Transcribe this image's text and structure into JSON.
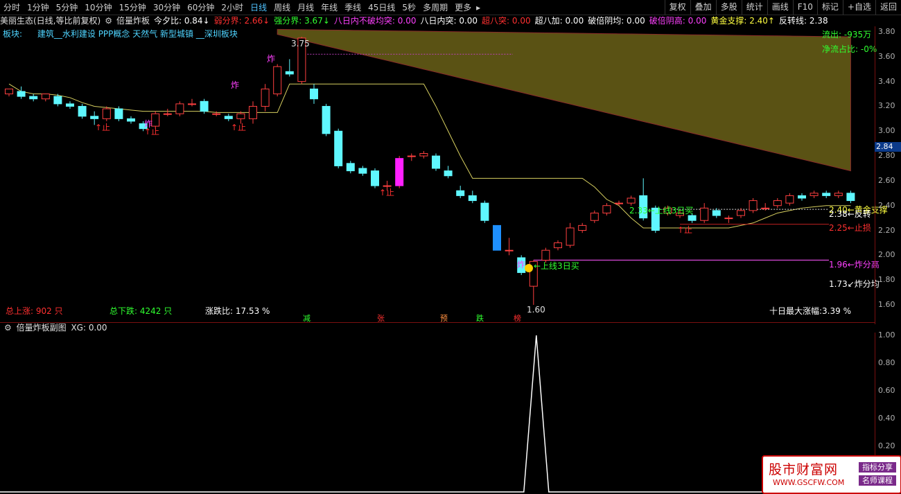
{
  "toolbar": {
    "periods": [
      "分时",
      "1分钟",
      "5分钟",
      "10分钟",
      "15分钟",
      "30分钟",
      "60分钟",
      "2小时",
      "日线",
      "周线",
      "月线",
      "年线",
      "季线",
      "45日线",
      "5秒",
      "多周期",
      "更多"
    ],
    "active_period": "日线",
    "more_arrow": "▸",
    "right_buttons": [
      "复权",
      "叠加",
      "多股",
      "统计",
      "画线",
      "F10",
      "标记",
      "+自选",
      "返回"
    ]
  },
  "info": {
    "stock": "美丽生态(日线,等比前复权)",
    "indicator": "倍量炸板",
    "items": [
      {
        "label": "今夕比: 0.84↓",
        "color": "#ffffff"
      },
      {
        "label": "弱分界: 2.66↓",
        "color": "#ff3030"
      },
      {
        "label": "强分界: 3.67↓",
        "color": "#30ff30"
      },
      {
        "label": "八日内不破均突: 0.00",
        "color": "#ff40ff"
      },
      {
        "label": "八日内突: 0.00",
        "color": "#ffffff"
      },
      {
        "label": "超八突: 0.00",
        "color": "#ff3030"
      },
      {
        "label": "超八加: 0.00",
        "color": "#ffffff"
      },
      {
        "label": "破倍阴均: 0.00",
        "color": "#ffffff"
      },
      {
        "label": "破倍阴高: 0.00",
        "color": "#ff40ff"
      },
      {
        "label": "黄金支撑: 2.40↑",
        "color": "#ffff40"
      },
      {
        "label": "反转线: 2.38",
        "color": "#ffffff"
      }
    ]
  },
  "block": {
    "label": "板块:",
    "value": "建筑__水利建设 PPP概念 天然气 新型城镇 __深圳板块"
  },
  "chart_texts": {
    "outflow": "流出: -935万",
    "net_ratio": "净流占比: -0%",
    "peak": "3.75",
    "zha1": "炸",
    "zha2": "炸",
    "zha3": "炸",
    "zhang1": "↑止",
    "zhang2": "↑止",
    "zhang3": "↑止",
    "zhang4": "↑止",
    "zhang5": "↑止",
    "low": "1.60",
    "upline1": "2.33←上线3日买",
    "upline2": "←上线3日买",
    "zha_low": "炸",
    "support": "2.40←黄金支撑",
    "reversal": "2.38←反转",
    "stoploss": "2.25←止损",
    "zha_avg1": "1.96←炸分高",
    "zha_avg2": "1.73↙炸分均",
    "total_up_label": "总上涨:",
    "total_up": "902 只",
    "total_down_label": "总下跌:",
    "total_down": "4242 只",
    "ratio_label": "涨跌比:",
    "ratio": "17.53 %",
    "tags": [
      "减",
      "张",
      "预",
      "跌",
      "榜"
    ],
    "ten_day": "十日最大涨幅:3.39 %"
  },
  "axis": {
    "labels": [
      "3.80",
      "3.60",
      "3.40",
      "3.20",
      "3.00",
      "2.80",
      "2.60",
      "2.40",
      "2.20",
      "2.00",
      "1.80",
      "1.60"
    ],
    "current": "2.84",
    "sub_labels": [
      "1.00",
      "0.80",
      "0.60",
      "0.40",
      "0.20",
      "0.00"
    ]
  },
  "sub": {
    "title": "倍量炸板副图",
    "value": "XG: 0.00"
  },
  "logo": {
    "title": "股市财富网",
    "url": "WWW.GSCFW.COM",
    "badge1": "指标分享",
    "badge2": "名师课程"
  },
  "chart_data": {
    "type": "candlestick",
    "price_range": [
      1.6,
      3.8
    ],
    "candles": [
      [
        3.3,
        3.34,
        3.28,
        3.32
      ],
      [
        3.32,
        3.28,
        3.36,
        3.26
      ],
      [
        3.28,
        3.26,
        3.3,
        3.24
      ],
      [
        3.26,
        3.3,
        3.24,
        3.28
      ],
      [
        3.28,
        3.22,
        3.3,
        3.2
      ],
      [
        3.22,
        3.2,
        3.24,
        3.18
      ],
      [
        3.2,
        3.12,
        3.22,
        3.1
      ],
      [
        3.12,
        3.1,
        3.16,
        3.05
      ],
      [
        3.1,
        3.18,
        3.08,
        3.2
      ],
      [
        3.18,
        3.1,
        3.2,
        3.08
      ],
      [
        3.1,
        3.08,
        3.12,
        3.06
      ],
      [
        3.06,
        3.02,
        3.08,
        3.0
      ],
      [
        3.04,
        3.14,
        3.02,
        3.16
      ],
      [
        3.14,
        3.14,
        3.18,
        3.12
      ],
      [
        3.14,
        3.22,
        3.12,
        3.24
      ],
      [
        3.22,
        3.22,
        3.26,
        3.2
      ],
      [
        3.24,
        3.16,
        3.26,
        3.14
      ],
      [
        3.14,
        3.14,
        3.16,
        3.12
      ],
      [
        3.12,
        3.1,
        3.14,
        3.08
      ],
      [
        3.1,
        3.14,
        3.06,
        3.16
      ],
      [
        3.1,
        3.2,
        3.06,
        3.24
      ],
      [
        3.2,
        3.34,
        3.16,
        3.38
      ],
      [
        3.3,
        3.52,
        3.28,
        3.54
      ],
      [
        3.48,
        3.46,
        3.58,
        3.44
      ],
      [
        3.4,
        3.75,
        3.38,
        3.76
      ],
      [
        3.34,
        3.26,
        3.38,
        3.22
      ],
      [
        3.2,
        2.98,
        3.22,
        2.96
      ],
      [
        3.0,
        2.72,
        3.02,
        2.7
      ],
      [
        2.74,
        2.68,
        2.76,
        2.66
      ],
      [
        2.7,
        2.66,
        2.72,
        2.64
      ],
      [
        2.68,
        2.56,
        2.7,
        2.54
      ],
      [
        2.56,
        2.56,
        2.6,
        2.52
      ],
      [
        2.56,
        2.78,
        2.54,
        2.8
      ],
      [
        2.8,
        2.8,
        2.82,
        2.76
      ],
      [
        2.8,
        2.82,
        2.84,
        2.78
      ],
      [
        2.8,
        2.7,
        2.82,
        2.68
      ],
      [
        2.68,
        2.64,
        2.72,
        2.62
      ],
      [
        2.52,
        2.48,
        2.56,
        2.46
      ],
      [
        2.48,
        2.44,
        2.52,
        2.42
      ],
      [
        2.42,
        2.28,
        2.44,
        2.26
      ],
      [
        2.24,
        2.04,
        2.24,
        2.04
      ],
      [
        2.04,
        2.04,
        2.14,
        2.0
      ],
      [
        1.98,
        1.86,
        2.0,
        1.84
      ],
      [
        1.75,
        1.95,
        1.6,
        1.96
      ],
      [
        1.96,
        2.04,
        1.94,
        2.06
      ],
      [
        2.06,
        2.1,
        2.04,
        2.12
      ],
      [
        2.08,
        2.22,
        2.06,
        2.26
      ],
      [
        2.2,
        2.24,
        2.18,
        2.26
      ],
      [
        2.28,
        2.34,
        2.26,
        2.36
      ],
      [
        2.34,
        2.4,
        2.32,
        2.42
      ],
      [
        2.42,
        2.42,
        2.44,
        2.4
      ],
      [
        2.42,
        2.46,
        2.4,
        2.48
      ],
      [
        2.48,
        2.3,
        2.62,
        2.28
      ],
      [
        2.38,
        2.2,
        2.4,
        2.18
      ],
      [
        2.34,
        2.38,
        2.32,
        2.4
      ],
      [
        2.32,
        2.34,
        2.3,
        2.36
      ],
      [
        2.32,
        2.28,
        2.34,
        2.26
      ],
      [
        2.28,
        2.38,
        2.26,
        2.42
      ],
      [
        2.36,
        2.32,
        2.38,
        2.3
      ],
      [
        2.3,
        2.3,
        2.32,
        2.26
      ],
      [
        2.32,
        2.36,
        2.3,
        2.38
      ],
      [
        2.36,
        2.44,
        2.34,
        2.46
      ],
      [
        2.38,
        2.38,
        2.42,
        2.36
      ],
      [
        2.4,
        2.44,
        2.38,
        2.46
      ],
      [
        2.42,
        2.48,
        2.4,
        2.5
      ],
      [
        2.48,
        2.46,
        2.5,
        2.44
      ],
      [
        2.48,
        2.5,
        2.46,
        2.52
      ],
      [
        2.5,
        2.48,
        2.52,
        2.46
      ],
      [
        2.48,
        2.5,
        2.46,
        2.52
      ],
      [
        2.5,
        2.44,
        2.52,
        2.42
      ]
    ],
    "sub_signal": {
      "index": 43,
      "value": 1.0,
      "range": [
        0,
        1
      ]
    }
  }
}
